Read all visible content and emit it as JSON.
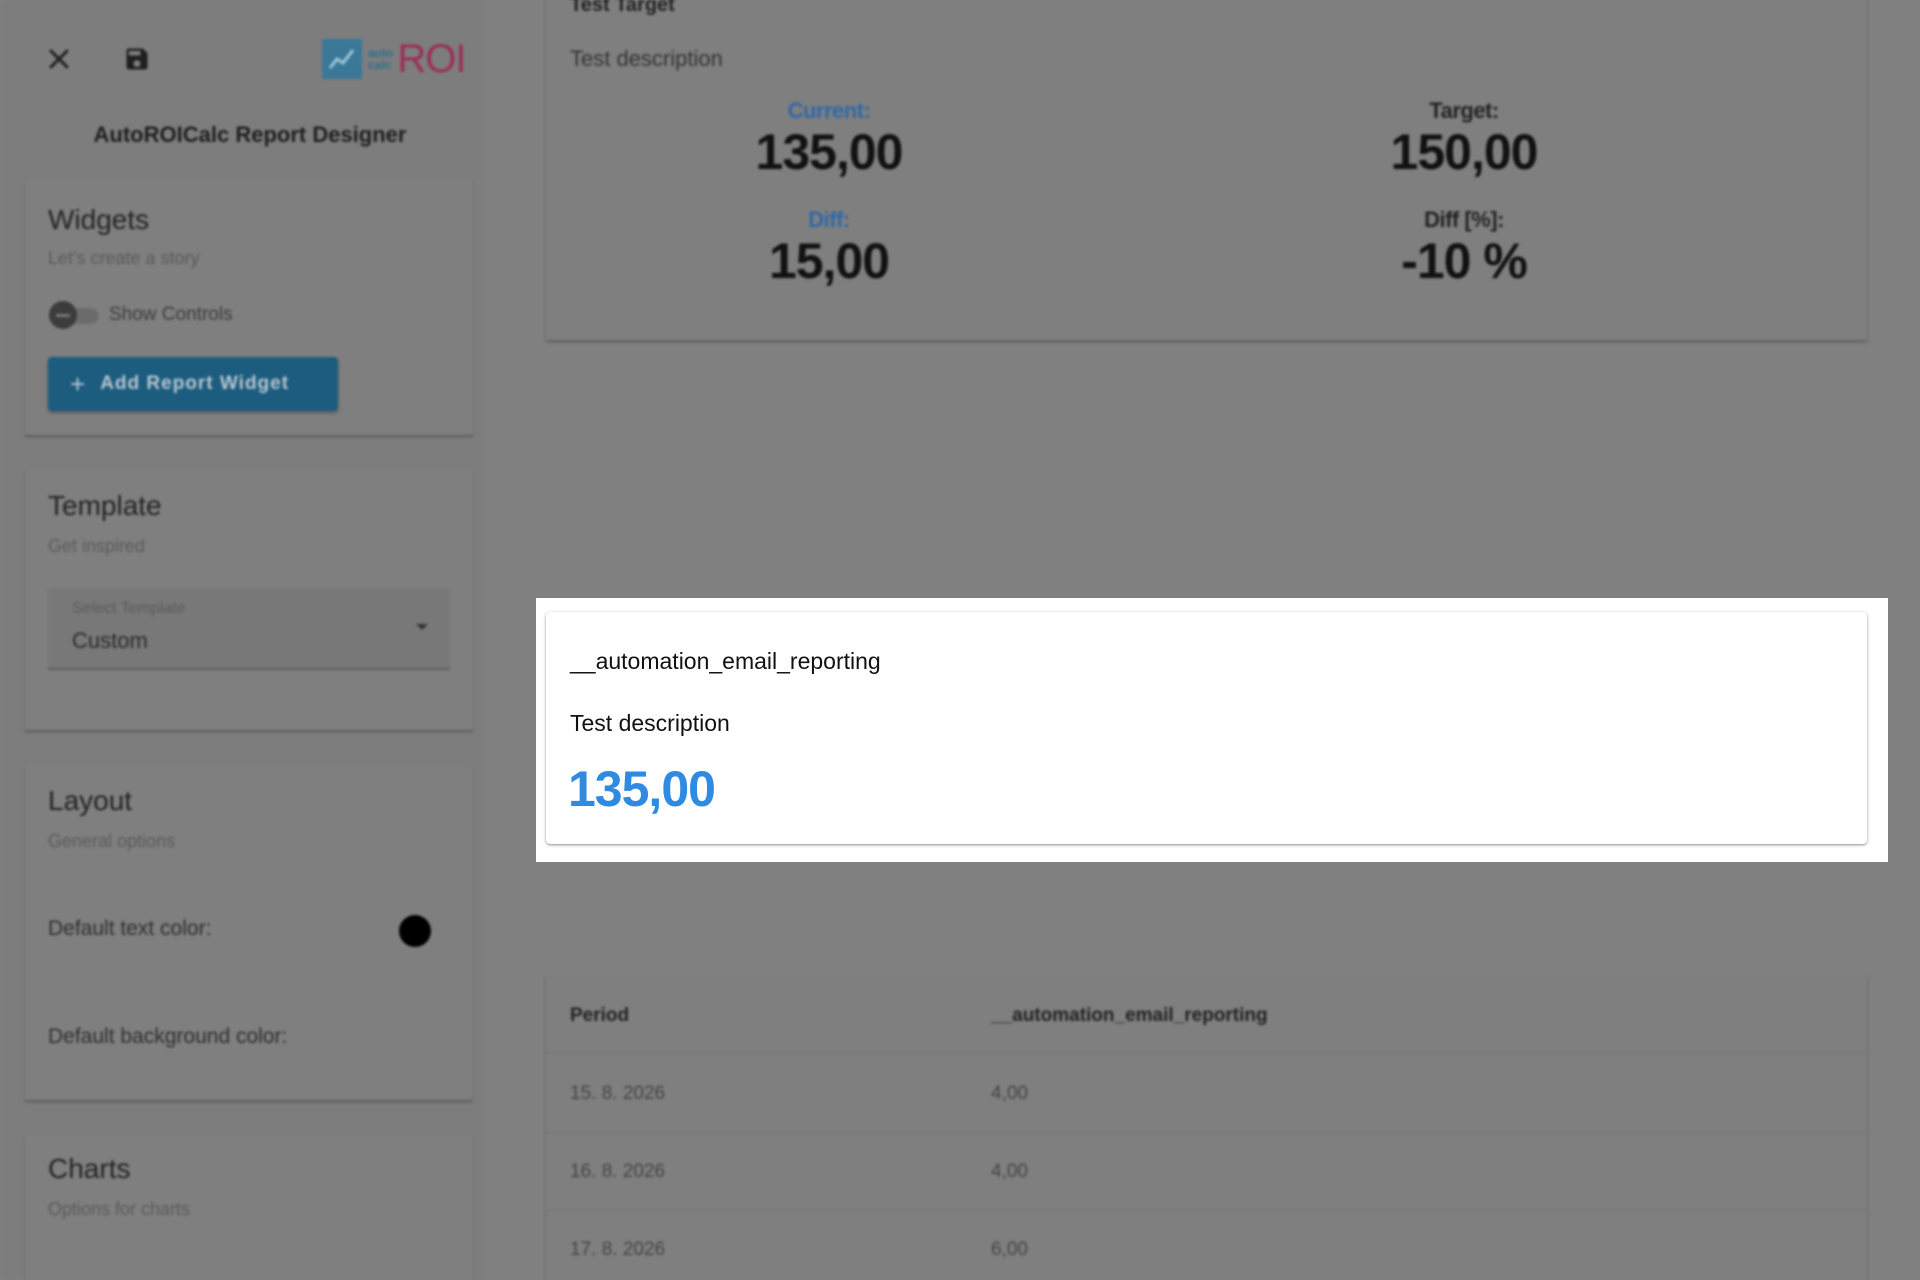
{
  "sidebar": {
    "logo": {
      "small_top": "auto",
      "small_bottom": "calc",
      "big": "ROI"
    },
    "app_title": "AutoROICalc Report Designer",
    "widgets": {
      "title": "Widgets",
      "subtitle": "Let's create a story",
      "toggle_label": "Show Controls",
      "add_button": "Add Report Widget"
    },
    "template": {
      "title": "Template",
      "subtitle": "Get inspired",
      "select_label": "Select Template",
      "select_value": "Custom"
    },
    "layout": {
      "title": "Layout",
      "subtitle": "General options",
      "text_color_label": "Default text color:",
      "text_color": "#000000",
      "bg_color_label": "Default background color:"
    },
    "charts": {
      "title": "Charts",
      "subtitle": "Options for charts"
    }
  },
  "main": {
    "target_widget": {
      "title": "Test Target",
      "description": "Test description",
      "current_label": "Current:",
      "current_value": "135,00",
      "target_label": "Target:",
      "target_value": "150,00",
      "diff_label": "Diff:",
      "diff_value": "15,00",
      "diff_pct_label": "Diff [%]:",
      "diff_pct_value": "-10 %"
    },
    "value_widget": {
      "title": "__automation_email_reporting",
      "description": "Test description",
      "value": "135,00",
      "value_color": "#2f8be2"
    },
    "table_widget": {
      "headers": [
        "Period",
        "__automation_email_reporting"
      ],
      "rows": [
        [
          "15. 8. 2026",
          "4,00"
        ],
        [
          "16. 8. 2026",
          "4,00"
        ],
        [
          "17. 8. 2026",
          "6,00"
        ]
      ]
    }
  }
}
